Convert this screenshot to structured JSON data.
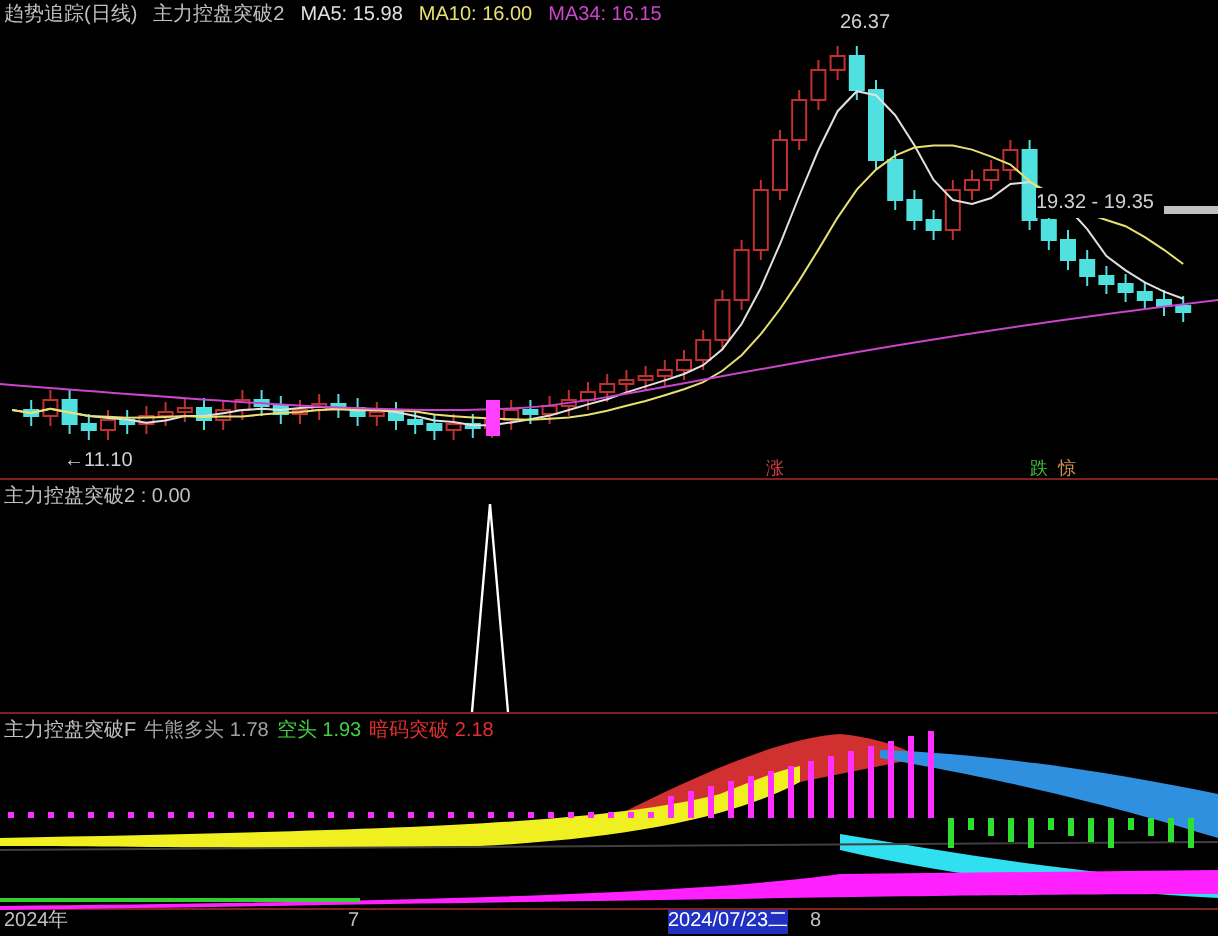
{
  "top": {
    "title": "趋势追踪(日线)",
    "indicator": "主力控盘突破2",
    "ma": [
      {
        "label": "MA5: 15.98",
        "color": "#e0e0e0"
      },
      {
        "label": "MA10: 16.00",
        "color": "#e8e070"
      },
      {
        "label": "MA34: 16.15",
        "color": "#cc44cc"
      }
    ],
    "price_labels": [
      "26.37",
      "←11.10",
      "19.32 - 19.35"
    ],
    "signals": [
      {
        "text": "涨",
        "color": "#d04040"
      },
      {
        "text": "跌",
        "color": "#40c040"
      },
      {
        "text": "惊",
        "color": "#d09050"
      }
    ]
  },
  "middle": {
    "title": "主力控盘突破2 : 0.00"
  },
  "bottom": {
    "title": "主力控盘突破F",
    "values": [
      {
        "label": "牛熊多头",
        "value": "1.78",
        "color": "#a0a0a0"
      },
      {
        "label": "空头",
        "value": "1.93",
        "color": "#40d040"
      },
      {
        "label": "暗码突破",
        "value": "2.18",
        "color": "#e03030"
      }
    ]
  },
  "axis": [
    {
      "text": "2024年",
      "selected": false
    },
    {
      "text": "7",
      "selected": false
    },
    {
      "text": "2024/07/23二",
      "selected": true
    },
    {
      "text": "8",
      "selected": false
    }
  ]
}
